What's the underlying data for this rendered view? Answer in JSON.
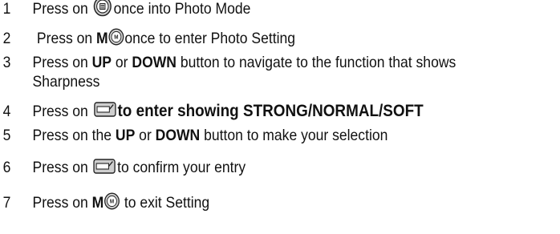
{
  "steps": [
    {
      "number": "1",
      "pre": "Press on",
      "post": "once into Photo Mode",
      "icon": "menu-button-icon"
    },
    {
      "number": "2",
      "pre": "Press on",
      "bold": "M",
      "post": "once to enter Photo Setting",
      "icon": "m-button-icon",
      "icon_letter": "M"
    },
    {
      "number": "3",
      "pre": "Press on",
      "bold1": "UP",
      "mid": "or",
      "bold2": "DOWN",
      "post": "button to navigate to the function that shows",
      "cont": "Sharpness"
    },
    {
      "number": "4",
      "pre": "Press on",
      "bold": "to enter showing STRONG/NORMAL/SOFT",
      "icon": "ok-button-icon"
    },
    {
      "number": "5",
      "pre": "Press on the",
      "bold1": "UP",
      "mid": "or",
      "bold2": "DOWN",
      "post": "button to make your selection"
    },
    {
      "number": "6",
      "pre": "Press on",
      "post": "to confirm your entry",
      "icon": "ok-button-icon"
    },
    {
      "number": "7",
      "pre": "Press on",
      "bold": "M",
      "post": "to exit Setting",
      "icon": "m-button-icon",
      "icon_letter": "M"
    }
  ],
  "colors": {
    "text": "#111111",
    "icon_fill": "#cfcfcf",
    "icon_stroke": "#222222"
  }
}
